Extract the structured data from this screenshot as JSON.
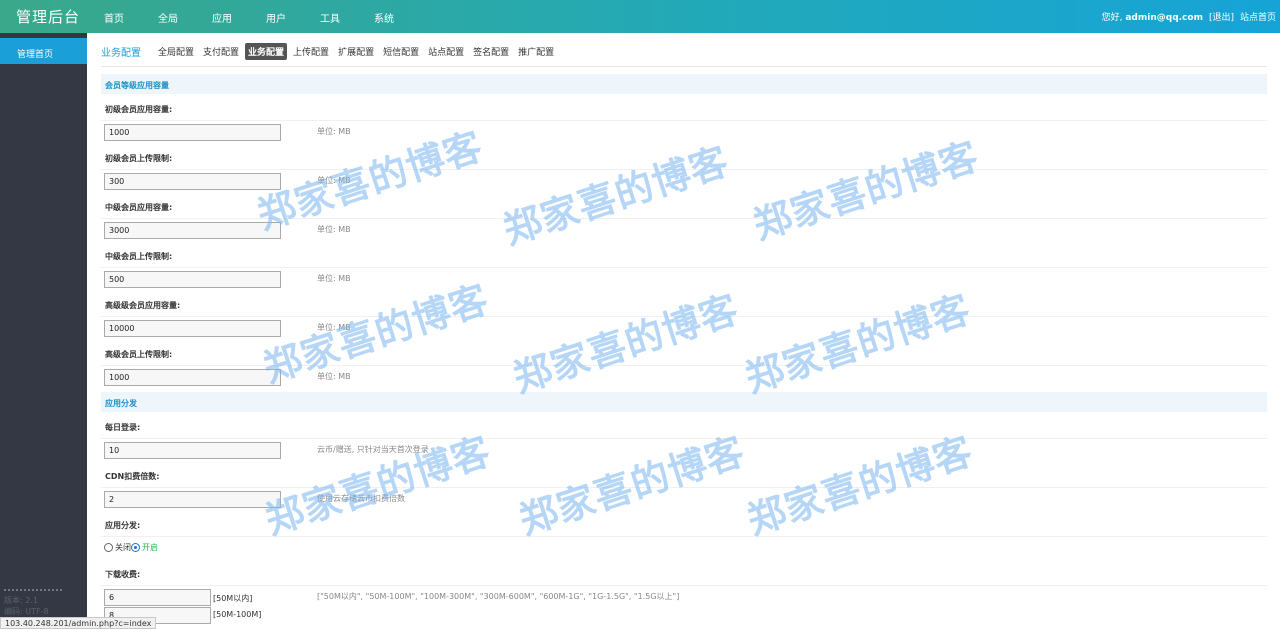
{
  "header": {
    "logo": "管理后台",
    "nav": [
      "首页",
      "全局",
      "应用",
      "用户",
      "工具",
      "系统"
    ],
    "greeting": "您好,",
    "user": "admin@qq.com",
    "logout": "[退出]",
    "site_home": "站点首页"
  },
  "sidebar": {
    "active_item": "管理首页",
    "info_line1": "版本: 2.1",
    "info_line2": "编码: UTF-8"
  },
  "tabs": {
    "main": "业务配置",
    "items": [
      "全局配置",
      "支付配置",
      "业务配置",
      "上传配置",
      "扩展配置",
      "短信配置",
      "站点配置",
      "签名配置",
      "推广配置"
    ],
    "active_index": 2
  },
  "sections": {
    "member": "会员等级应用容量",
    "distribution": "应用分发"
  },
  "member_fields": [
    {
      "label": "初级会员应用容量:",
      "value": "1000",
      "hint": "单位: MB"
    },
    {
      "label": "初级会员上传限制:",
      "value": "300",
      "hint": "单位: MB"
    },
    {
      "label": "中级会员应用容量:",
      "value": "3000",
      "hint": "单位: MB"
    },
    {
      "label": "中级会员上传限制:",
      "value": "500",
      "hint": "单位: MB"
    },
    {
      "label": "高级级会员应用容量:",
      "value": "10000",
      "hint": "单位: MB"
    },
    {
      "label": "高级会员上传限制:",
      "value": "1000",
      "hint": "单位: MB"
    }
  ],
  "distribution": {
    "daily_login": {
      "label": "每日登录:",
      "value": "10",
      "hint": "云币/赠送, 只针对当天首次登录"
    },
    "cdn": {
      "label": "CDN扣费倍数:",
      "value": "2",
      "hint": "使用云存储云币扣费倍数"
    },
    "app_dist": {
      "label": "应用分发:",
      "off": "关闭",
      "on": "开启",
      "selected": "on"
    },
    "download_fee": {
      "label": "下载收费:",
      "rows": [
        {
          "value": "6",
          "tag": "[50M以内]"
        },
        {
          "value": "8",
          "tag": "[50M-100M]"
        }
      ],
      "hint": "[\"50M以内\", \"50M-100M\", \"100M-300M\", \"300M-600M\", \"600M-1G\", \"1G-1.5G\", \"1.5G以上\"]"
    }
  },
  "watermark": "郑家喜的博客",
  "status_url": "103.40.248.201/admin.php?c=index"
}
